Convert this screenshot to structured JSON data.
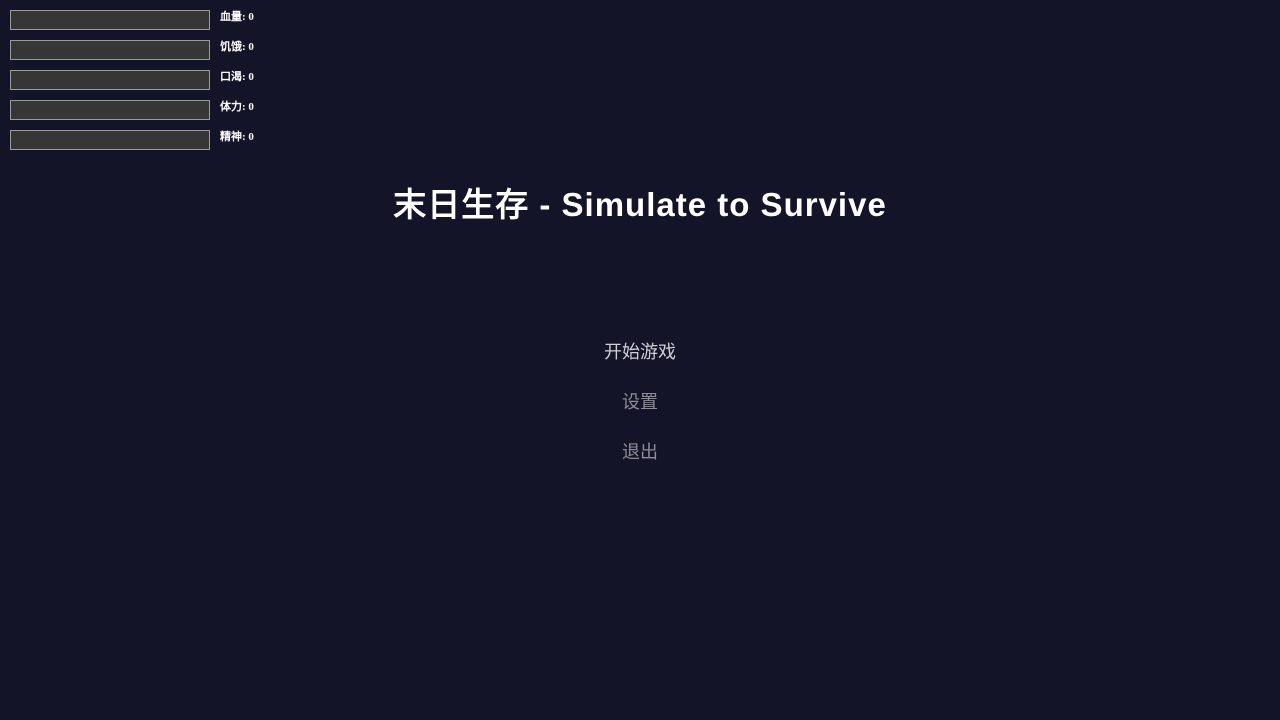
{
  "stats": [
    {
      "label": "血量",
      "value": "0",
      "level": 0
    },
    {
      "label": "饥饿",
      "value": "0",
      "level": 0
    },
    {
      "label": "口渴",
      "value": "0",
      "level": 0
    },
    {
      "label": "体力",
      "value": "0",
      "level": 0
    },
    {
      "label": "精神",
      "value": "0",
      "level": 0
    }
  ],
  "title": "末日生存 - Simulate to Survive",
  "menu": {
    "start": "开始游戏",
    "settings": "设置",
    "exit": "退出"
  },
  "colors": {
    "background": "#131428",
    "bar_background": "#363636",
    "bar_border": "#9a9a9a",
    "title": "#ffffff"
  }
}
